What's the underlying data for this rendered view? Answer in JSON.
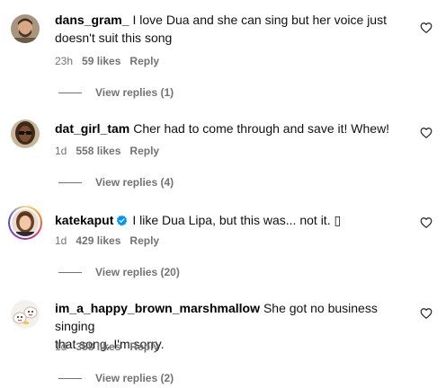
{
  "comments": [
    {
      "username": "dans_gram_",
      "text_line1": "I love Dua and she can sing but her voice just",
      "text_line2": "doesn't suit this song",
      "time": "23h",
      "likes": "59 likes",
      "reply": "Reply",
      "view_replies": "View replies (1)",
      "avatar_icon": "avatar-man-beard"
    },
    {
      "username": "dat_girl_tam",
      "text_line1": "Cher had to come through and save it! Whew!",
      "time": "1d",
      "likes": "558 likes",
      "reply": "Reply",
      "view_replies": "View replies (4)",
      "avatar_icon": "avatar-woman-glasses"
    },
    {
      "username": "katekaput",
      "verified": true,
      "text_line1": "I like Dua Lipa, but this was... not it. ▯",
      "time": "1d",
      "likes": "429 likes",
      "reply": "Reply",
      "view_replies": "View replies (20)",
      "avatar_icon": "avatar-woman-story-ring"
    },
    {
      "username": "im_a_happy_brown_marshmallow",
      "text_line1": "She got no business singing",
      "text_line2": "that song. I'm sorry.",
      "time": "1d",
      "likes": "358 likes",
      "reply": "Reply",
      "view_replies": "View replies (2)",
      "avatar_icon": "avatar-marshmallow-illustration"
    }
  ],
  "colors": {
    "text": "#000000",
    "meta": "#737373",
    "verified": "#0095f6",
    "background": "#ffffff"
  },
  "icons": {
    "like": "heart-outline-icon",
    "verified": "verified-badge-icon"
  }
}
